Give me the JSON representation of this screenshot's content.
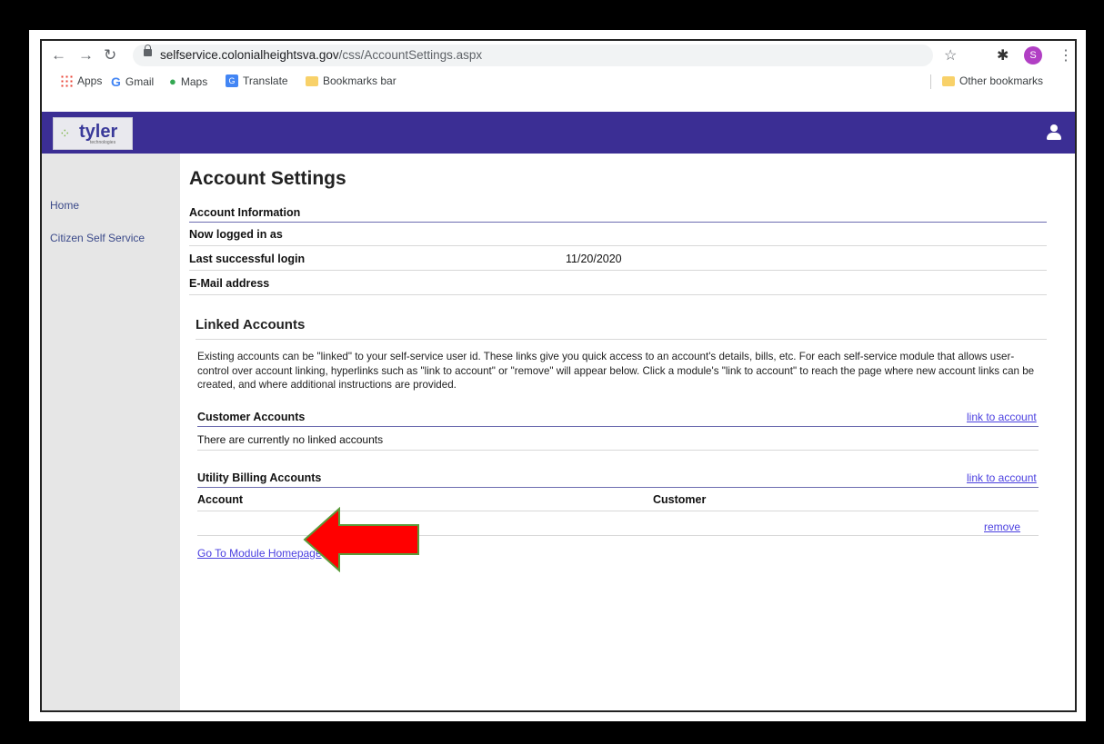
{
  "browser": {
    "url_host": "selfservice.colonialheightsva.gov",
    "url_path": "/css/AccountSettings.aspx",
    "profile_initial": "S",
    "bookmarks": [
      "Apps",
      "Gmail",
      "Maps",
      "Translate",
      "Bookmarks bar"
    ],
    "other_bookmarks": "Other bookmarks"
  },
  "app": {
    "logo_word": "tyler",
    "logo_sub": "technologies"
  },
  "sidebar": {
    "items": [
      {
        "label": "Home"
      },
      {
        "label": "Citizen Self Service"
      }
    ]
  },
  "page": {
    "title": "Account Settings",
    "account_information": "Account Information",
    "rows": [
      {
        "label": "Now logged in as",
        "value": ""
      },
      {
        "label": "Last successful login",
        "value": "11/20/2020"
      },
      {
        "label": "E-Mail address",
        "value": ""
      }
    ],
    "linked_title": "Linked Accounts",
    "linked_desc": "Existing accounts can be \"linked\" to your self-service user id. These links give you quick access to an account's details, bills, etc. For each self-service module that allows user-control over account linking, hyperlinks such as \"link to account\" or \"remove\" will appear below. Click a module's \"link to account\" to reach the page where new account links can be created, and where additional instructions are provided.",
    "customer_accounts": {
      "title": "Customer Accounts",
      "link": "link to account",
      "empty": "There are currently no linked accounts"
    },
    "utility_accounts": {
      "title": "Utility Billing Accounts",
      "link": "link to account",
      "col_account": "Account",
      "col_customer": "Customer",
      "remove": "remove"
    },
    "module_home": "Go To Module Homepage"
  },
  "colors": {
    "appbar": "#3b2e94",
    "link": "#4a3fe0",
    "arrow": "#ff0000"
  }
}
